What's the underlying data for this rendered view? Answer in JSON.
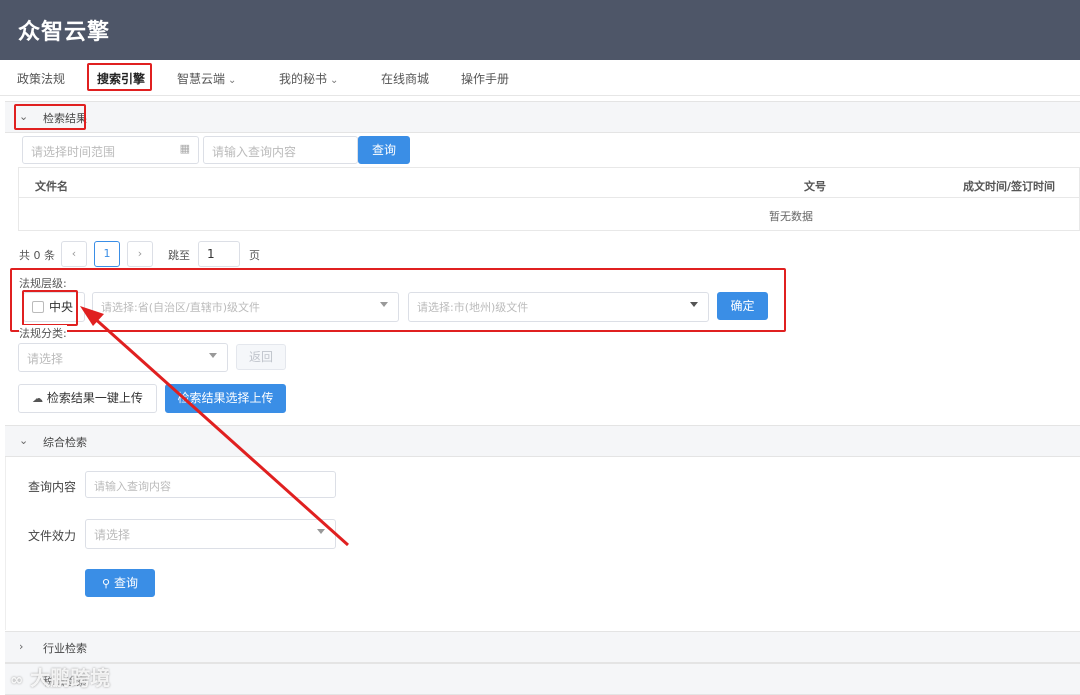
{
  "app": {
    "logo": "众智云擎"
  },
  "nav": [
    {
      "label": "政策法规",
      "chevron": false
    },
    {
      "label": "搜索引擎",
      "chevron": false,
      "active": true
    },
    {
      "label": "智慧云端",
      "chevron": true
    },
    {
      "label": "我的秘书",
      "chevron": true
    },
    {
      "label": "在线商城",
      "chevron": false
    },
    {
      "label": "操作手册",
      "chevron": false
    }
  ],
  "results": {
    "title": "检索结果",
    "date_placeholder": "请选择时间范围",
    "query_placeholder": "请输入查询内容",
    "query_button": "查询",
    "columns": [
      "文件名",
      "文号",
      "成文时间/签订时间"
    ],
    "empty_text": "暂无数据",
    "pagination": {
      "total": "共 0 条",
      "current": "1",
      "goto_label": "跳至",
      "goto_value": "1",
      "page_suffix": "页"
    },
    "level_label": "法规层级:",
    "central_label": "中央",
    "province_placeholder": "请选择:省(自治区/直辖市)级文件",
    "city_placeholder": "请选择:市(地州)级文件",
    "confirm_button": "确定",
    "category_label": "法规分类:",
    "category_placeholder": "请选择",
    "back_button": "返回",
    "upload_all_button": "检索结果一键上传",
    "upload_selected_button": "检索结果选择上传"
  },
  "combined": {
    "title": "综合检索",
    "query_label": "查询内容",
    "query_placeholder": "请输入查询内容",
    "effect_label": "文件效力",
    "effect_placeholder": "请选择",
    "search_button": "查询"
  },
  "industry": {
    "title": "行业检索"
  },
  "bottom": {
    "partial_title": "税法检索"
  },
  "watermark": "大鹏跨境",
  "colors": {
    "header": "#4e5668",
    "primary": "#3a8ee6",
    "annotation": "#e02020"
  }
}
